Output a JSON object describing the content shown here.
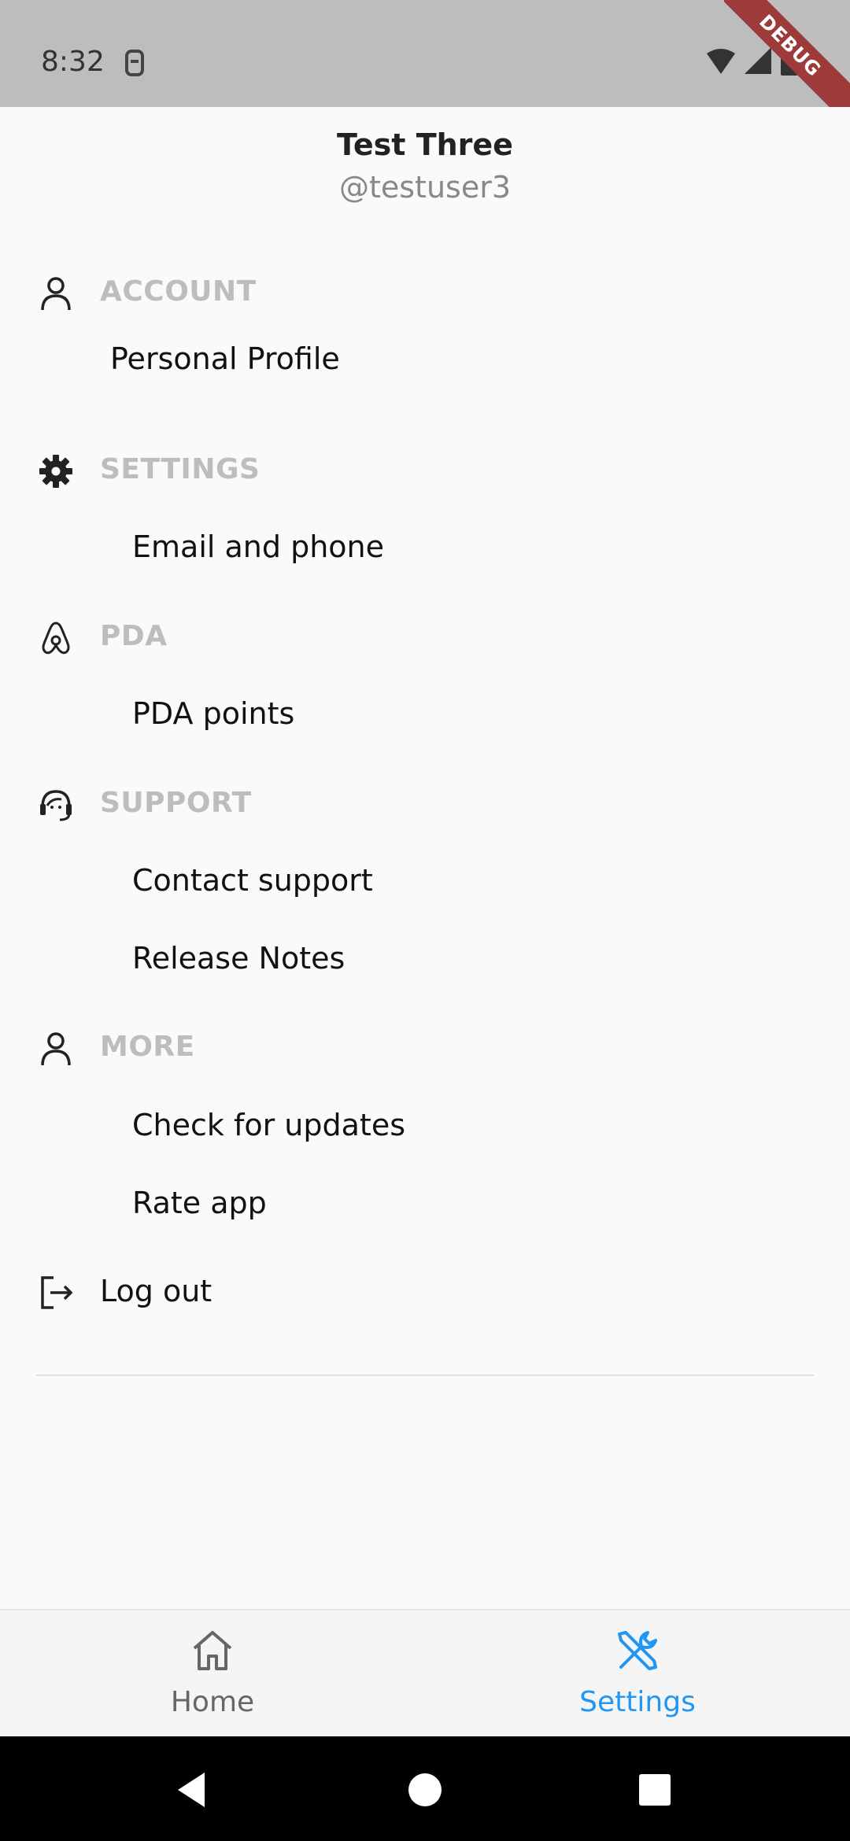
{
  "status_bar": {
    "time": "8:32",
    "icons": [
      "sim-icon",
      "wifi-icon",
      "signal-icon",
      "battery-icon"
    ]
  },
  "debug_banner": "DEBUG",
  "profile": {
    "name": "Test Three",
    "handle": "@testuser3"
  },
  "sections": {
    "account": {
      "title": "ACCOUNT",
      "icon": "person-icon",
      "items": [
        "Personal Profile"
      ]
    },
    "settings": {
      "title": "SETTINGS",
      "icon": "gear-icon",
      "items": [
        "Email and phone"
      ]
    },
    "pda": {
      "title": "PDA",
      "icon": "airbnb-logo-icon",
      "items": [
        "PDA points"
      ]
    },
    "support": {
      "title": "SUPPORT",
      "icon": "support-agent-icon",
      "items": [
        "Contact support",
        "Release Notes"
      ]
    },
    "more": {
      "title": "MORE",
      "icon": "person-icon",
      "items": [
        "Check for updates",
        "Rate app"
      ]
    }
  },
  "logout": {
    "label": "Log out",
    "icon": "logout-icon"
  },
  "bottom_nav": {
    "items": [
      {
        "label": "Home",
        "icon": "home-icon",
        "active": false
      },
      {
        "label": "Settings",
        "icon": "tools-icon",
        "active": true
      }
    ],
    "active_color": "#2196f3",
    "inactive_color": "#666666"
  },
  "system_nav": [
    "back-icon",
    "home-circle-icon",
    "recents-icon"
  ]
}
